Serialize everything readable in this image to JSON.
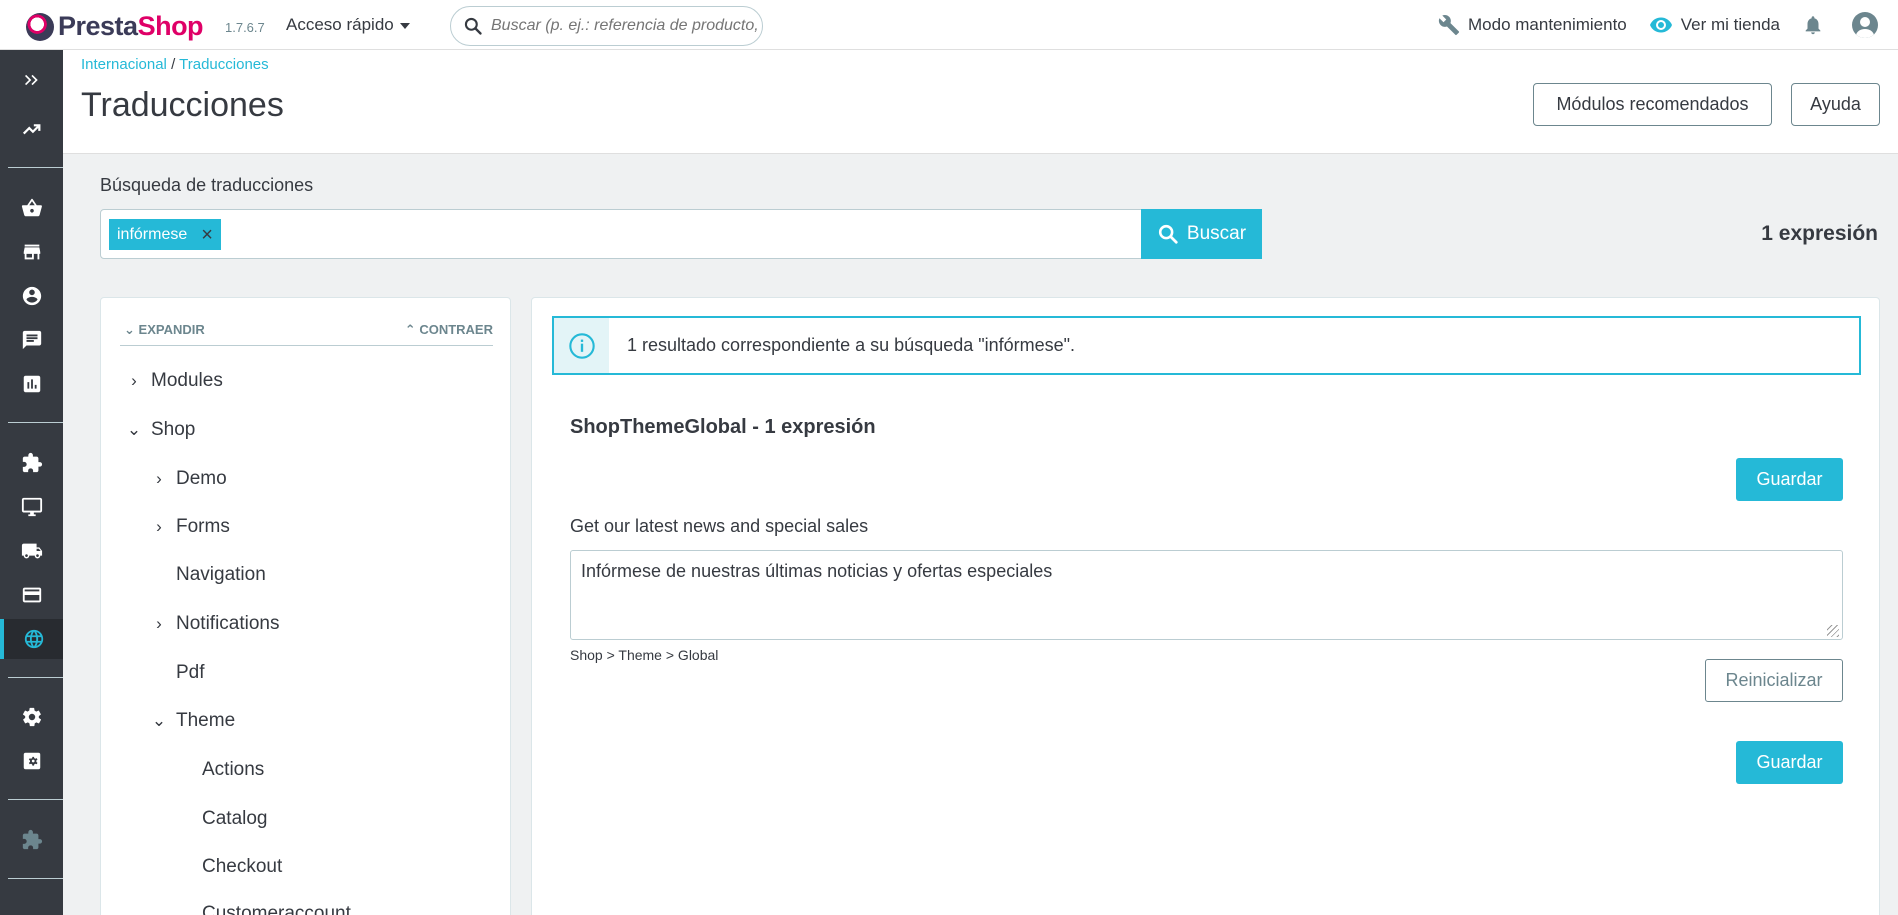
{
  "topbar": {
    "brand_part1": "Presta",
    "brand_part2": "Shop",
    "version": "1.7.6.7",
    "quick_access": "Acceso rápido",
    "search_placeholder": "Buscar (p. ej.: referencia de producto, no",
    "maintenance": "Modo mantenimiento",
    "view_shop": "Ver mi tienda"
  },
  "sidebar": {
    "items": [
      "expand-icon",
      "stats-trend-icon",
      "basket-icon",
      "store-icon",
      "customer-icon",
      "messages-icon",
      "stats-icon",
      "modules-icon",
      "design-icon",
      "shipping-icon",
      "payment-icon",
      "international-icon",
      "settings-icon",
      "advanced-settings-icon",
      "extension-icon"
    ],
    "active": "international-icon",
    "accent": "#25b9d7"
  },
  "header": {
    "breadcrumb_parent": "Internacional",
    "breadcrumb_sep": " / ",
    "breadcrumb_current": "Traducciones",
    "title": "Traducciones",
    "btn_modules": "Módulos recomendados",
    "btn_help": "Ayuda"
  },
  "search": {
    "label": "Búsqueda de traducciones",
    "tag": "infórmese",
    "tag_remove": "×",
    "button": "Buscar",
    "total": "1 expresión"
  },
  "tree": {
    "expand": "EXPANDIR",
    "collapse": "CONTRAER",
    "items": [
      {
        "label": "Modules",
        "chevron": "›"
      },
      {
        "label": "Shop",
        "chevron": "⌄"
      },
      {
        "label": "Demo",
        "chevron": "›"
      },
      {
        "label": "Forms",
        "chevron": "›"
      },
      {
        "label": "Navigation",
        "chevron": ""
      },
      {
        "label": "Notifications",
        "chevron": "›"
      },
      {
        "label": "Pdf",
        "chevron": ""
      },
      {
        "label": "Theme",
        "chevron": "⌄"
      },
      {
        "label": "Actions",
        "chevron": ""
      },
      {
        "label": "Catalog",
        "chevron": ""
      },
      {
        "label": "Checkout",
        "chevron": ""
      },
      {
        "label": "Customeraccount",
        "chevron": ""
      }
    ]
  },
  "results": {
    "alert": "1 resultado correspondiente a su búsqueda \"infórmese\".",
    "domain_title": "ShopThemeGlobal - 1 expresión",
    "save": "Guardar",
    "source": "Get our latest news and special sales",
    "translation": "Infórmese de nuestras últimas noticias y ofertas especiales",
    "path": "Shop > Theme > Global",
    "reset": "Reinicializar"
  }
}
